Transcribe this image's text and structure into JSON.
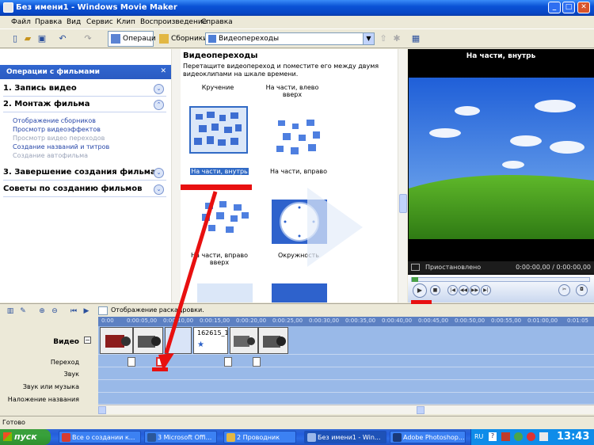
{
  "window": {
    "title": "Без имени1 - Windows Movie Maker"
  },
  "menu": [
    "Файл",
    "Правка",
    "Вид",
    "Сервис",
    "Клип",
    "Воспроизведение",
    "Справка"
  ],
  "toolbar": {
    "operations_label": "Операции",
    "collections_label": "Сборники",
    "combo_value": "Видеопереходы"
  },
  "taskpane": {
    "header": "Операции с фильмами",
    "sections": [
      {
        "label": "1. Запись видео"
      },
      {
        "label": "2. Монтаж фильма"
      },
      {
        "label": "3. Завершение создания фильма"
      },
      {
        "label": "Советы по созданию фильмов"
      }
    ],
    "links": [
      {
        "label": "Отображение сборников",
        "enabled": true
      },
      {
        "label": "Просмотр видеоэффектов",
        "enabled": true
      },
      {
        "label": "Просмотр видео переходов",
        "enabled": false
      },
      {
        "label": "Создание названий и титров",
        "enabled": true
      },
      {
        "label": "Создание автофильма",
        "enabled": false
      }
    ]
  },
  "collection": {
    "title": "Видеопереходы",
    "description": "Перетащите видеопереход и поместите его между двумя видеоклипами на шкале времени.",
    "items": [
      {
        "label": "Кручение"
      },
      {
        "label": "На части, влево вверх"
      },
      {
        "label": "На части, внутрь"
      },
      {
        "label": "На части, вправо"
      },
      {
        "label": "На части, вправо вверх"
      },
      {
        "label": "Окружность"
      }
    ]
  },
  "preview": {
    "title": "На части, внутрь",
    "status": "Приостановлено",
    "time": "0:00:00,00 / 0:00:00,00"
  },
  "timeline": {
    "mode_label": "Отображение раскадровки.",
    "tracks": [
      "Видео",
      "Переход",
      "Звук",
      "Звук или музыка",
      "Наложение названия"
    ],
    "ruler": [
      "0:00",
      "0:00:05,00",
      "0:00:10,00",
      "0:00:15,00",
      "0:00:20,00",
      "0:00:25,00",
      "0:00:30,00",
      "0:00:35,00",
      "0:00:40,00",
      "0:00:45,00",
      "0:00:50,00",
      "0:00:55,00",
      "0:01:00,00",
      "0:01:05"
    ],
    "clip_label": "162615_1"
  },
  "statusbar": {
    "text": "Готово"
  },
  "taskbar": {
    "start": "пуск",
    "items": [
      {
        "label": "Все о создании к..."
      },
      {
        "label": "3 Microsoft Offi..."
      },
      {
        "label": "2 Проводник"
      },
      {
        "label": "Без имени1 - Win..."
      },
      {
        "label": "Adobe Photoshop..."
      }
    ],
    "lang": "RU",
    "clock": "13:43"
  }
}
